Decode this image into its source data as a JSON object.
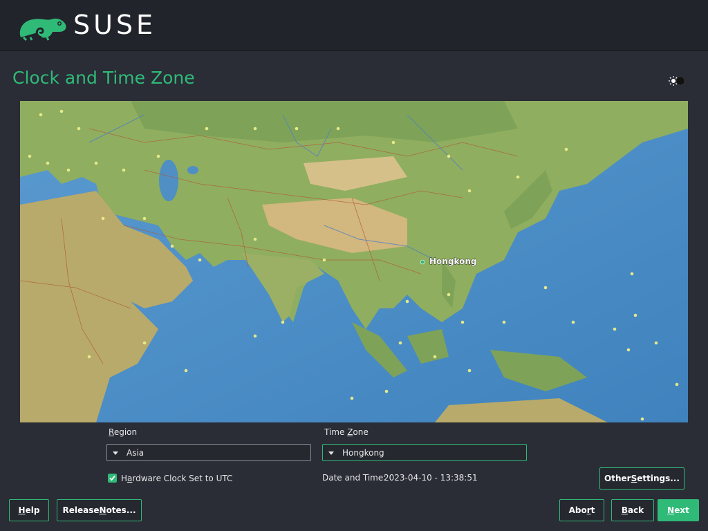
{
  "header": {
    "brand": "SUSE",
    "logo_icon": "suse-chameleon-icon"
  },
  "page": {
    "title": "Clock and Time Zone",
    "theme_toggle_icon": "sun-moon-icon"
  },
  "map": {
    "selected_city": "Hongkong",
    "marker_color": "#30ba78"
  },
  "region": {
    "label_pre": "",
    "label_mnemonic": "R",
    "label_post": "egion",
    "value": "Asia"
  },
  "timezone": {
    "label_pre": "Time ",
    "label_mnemonic": "Z",
    "label_post": "one",
    "value": "Hongkong"
  },
  "hwclock": {
    "label_pre": "H",
    "label_mnemonic": "a",
    "label_post": "rdware Clock Set to UTC",
    "checked": true
  },
  "datetime": {
    "label": "Date and Time:",
    "value": "2023-04-10 - 13:38:51"
  },
  "buttons": {
    "other_settings": {
      "pre": "Other ",
      "mn": "S",
      "post": "ettings..."
    },
    "help": {
      "pre": "",
      "mn": "H",
      "post": "elp"
    },
    "release_notes": {
      "pre": "Release ",
      "mn": "N",
      "post": "otes..."
    },
    "abort": {
      "pre": "Abo",
      "mn": "r",
      "post": "t"
    },
    "back": {
      "pre": "",
      "mn": "B",
      "post": "ack"
    },
    "next": {
      "pre": "",
      "mn": "N",
      "post": "ext"
    }
  },
  "colors": {
    "accent": "#30ba78",
    "background": "#2a2c36",
    "header": "#22242c"
  }
}
